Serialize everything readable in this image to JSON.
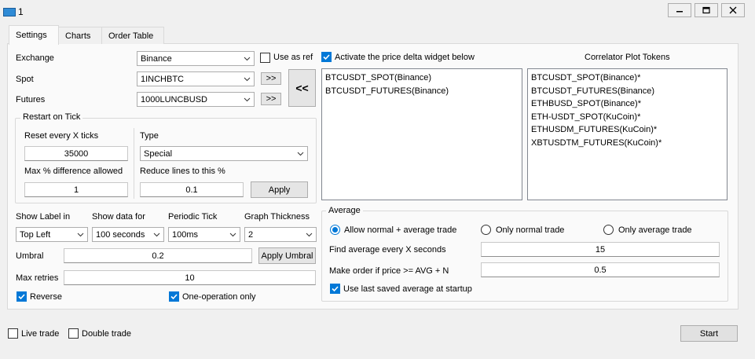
{
  "window": {
    "title": "1"
  },
  "tabs": [
    {
      "label": "Settings"
    },
    {
      "label": "Charts"
    },
    {
      "label": "Order Table"
    }
  ],
  "exchange": {
    "label": "Exchange",
    "value": "Binance",
    "use_as_ref_label": "Use as ref"
  },
  "spot": {
    "label": "Spot",
    "value": "1INCHBTC",
    "move_label": ">>"
  },
  "futures": {
    "label": "Futures",
    "value": "1000LUNCBUSD",
    "move_label": ">>"
  },
  "back_button_label": "<<",
  "restart_group": {
    "title": "Restart on Tick",
    "reset_label": "Reset every X ticks",
    "reset_value": "35000",
    "max_diff_label": "Max % difference allowed",
    "max_diff_value": "1",
    "type_label": "Type",
    "type_value": "Special",
    "reduce_label": "Reduce lines to this %",
    "reduce_value": "0.1",
    "apply_label": "Apply"
  },
  "show_label": {
    "label": "Show Label in",
    "value": "Top Left"
  },
  "show_data": {
    "label": "Show data for",
    "value": "100 seconds"
  },
  "periodic_tick": {
    "label": "Periodic Tick",
    "value": "100ms"
  },
  "graph_thickness": {
    "label": "Graph Thickness",
    "value": "2"
  },
  "umbral": {
    "label": "Umbral",
    "value": "0.2",
    "apply_label": "Apply Umbral"
  },
  "max_retries": {
    "label": "Max retries",
    "value": "10"
  },
  "reverse": {
    "label": "Reverse",
    "checked": true
  },
  "one_operation": {
    "label": "One-operation only",
    "checked": true
  },
  "price_delta": {
    "label": "Activate the price delta widget below",
    "checked": true,
    "items": [
      "BTCUSDT_SPOT(Binance)",
      "BTCUSDT_FUTURES(Binance)"
    ]
  },
  "correlator": {
    "title": "Correlator Plot Tokens",
    "items": [
      "BTCUSDT_SPOT(Binance)*",
      "BTCUSDT_FUTURES(Binance)",
      "ETHBUSD_SPOT(Binance)*",
      "ETH-USDT_SPOT(KuCoin)*",
      "ETHUSDM_FUTURES(KuCoin)*",
      "XBTUSDTM_FUTURES(KuCoin)*"
    ]
  },
  "average": {
    "title": "Average",
    "radio_allow": "Allow normal + average trade",
    "radio_normal": "Only normal trade",
    "radio_average": "Only average trade",
    "selected": "Allow normal + average trade",
    "find_label": "Find average every X seconds",
    "find_value": "15",
    "order_label": "Make order if price >= AVG + N",
    "order_value": "0.5",
    "use_last_label": "Use last saved average at startup",
    "use_last_checked": true
  },
  "footer": {
    "live_trade_label": "Live trade",
    "double_trade_label": "Double trade",
    "start_label": "Start"
  },
  "colors": {
    "accent": "#0078d7",
    "window_bg": "#f0f0f0",
    "panel_bg": "#fafafa"
  }
}
